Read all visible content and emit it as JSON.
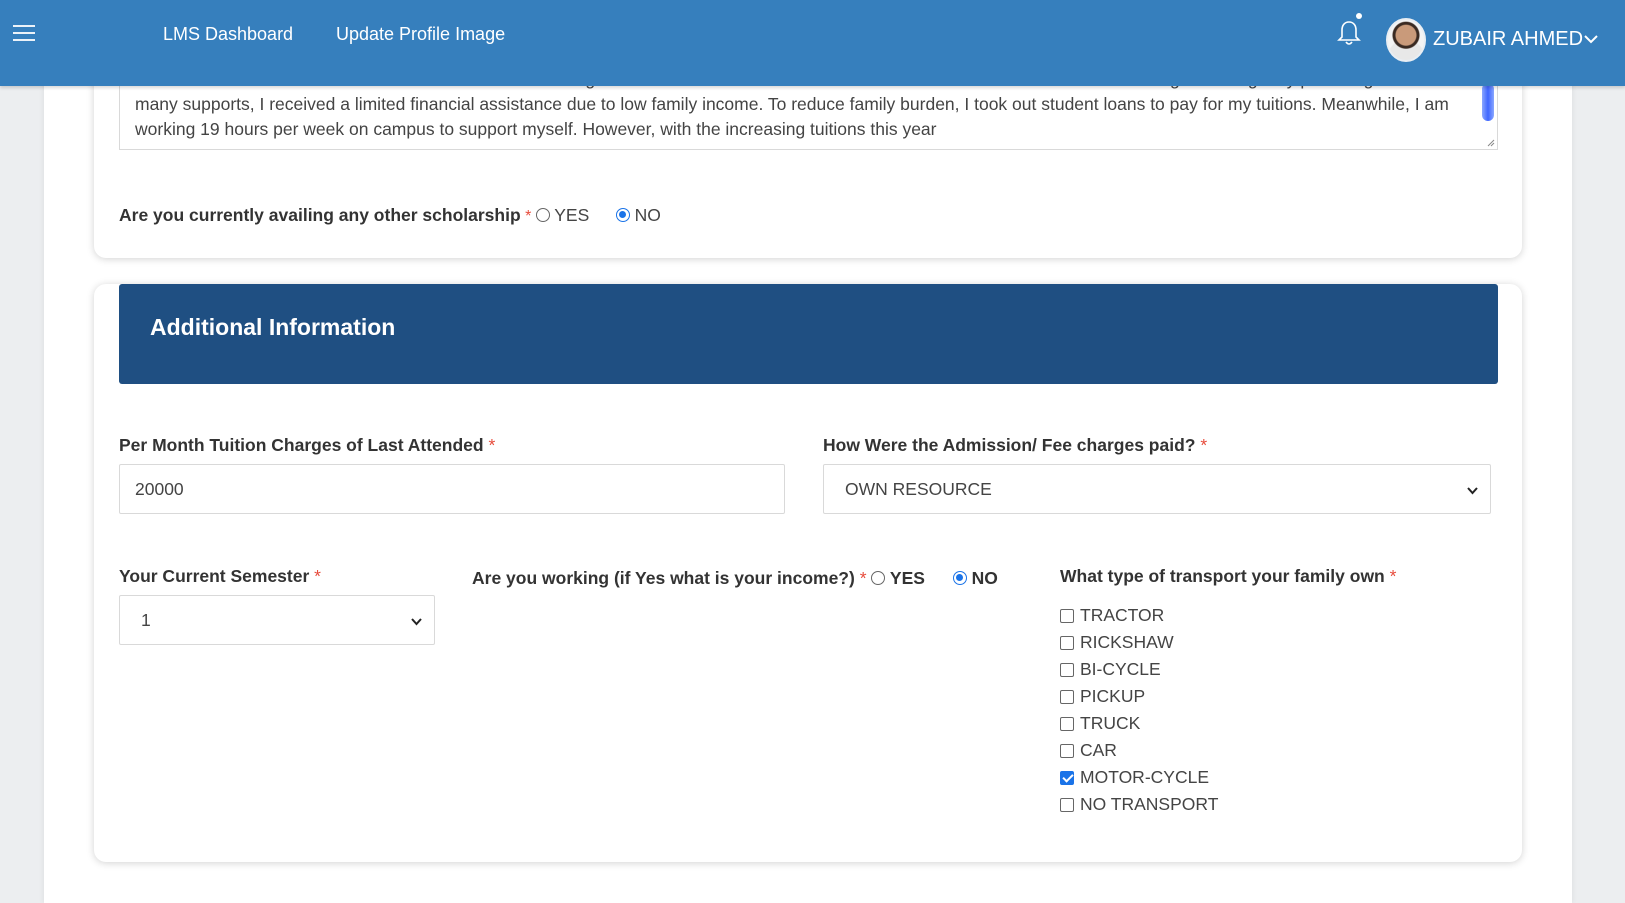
{
  "nav": {
    "links": [
      "LMS Dashboard",
      "Update Profile Image"
    ],
    "user_name": "ZUBAIR AHMED"
  },
  "financial": {
    "statement": "I am in need of financial assistance in order to attend college because I am a low-income student. I am the 1st child to attend the college. Although my parents gave me many supports, I received a limited financial assistance due to low family income. To reduce family burden, I took out student loans to pay for my tuitions. Meanwhile, I am working 19 hours per week on campus to support myself. However, with the increasing tuitions this year",
    "scholarship_question": "Are you currently availing any other scholarship",
    "required_mark": "*",
    "yes_label": "YES",
    "no_label": "NO",
    "scholarship_answer": "NO"
  },
  "additional": {
    "title": "Additional Information",
    "tuition_label": "Per Month Tuition Charges of Last Attended",
    "tuition_value": "20000",
    "fee_label": "How Were the Admission/ Fee charges paid?",
    "fee_value": "OWN RESOURCE",
    "semester_label": "Your Current Semester",
    "semester_value": "1",
    "working_label": "Are you working (if Yes what is your income?)",
    "working_answer": "NO",
    "transport_label": "What type of transport your family own",
    "transport_options": [
      {
        "label": "TRACTOR",
        "checked": false
      },
      {
        "label": "RICKSHAW",
        "checked": false
      },
      {
        "label": "BI-CYCLE",
        "checked": false
      },
      {
        "label": "PICKUP",
        "checked": false
      },
      {
        "label": "TRUCK",
        "checked": false
      },
      {
        "label": "CAR",
        "checked": false
      },
      {
        "label": "MOTOR-CYCLE",
        "checked": true
      },
      {
        "label": "NO TRANSPORT",
        "checked": false
      }
    ]
  },
  "colors": {
    "navbar": "#367fbd",
    "section_header": "#1f4f82",
    "required": "#e74c3c",
    "accent": "#1a73e8"
  }
}
